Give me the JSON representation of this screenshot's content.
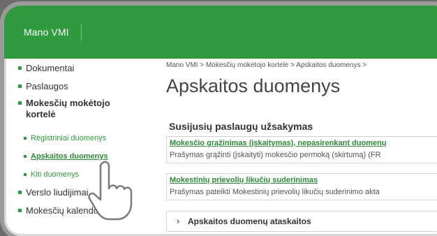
{
  "header": {
    "brand": "Mano VMI"
  },
  "sidebar": {
    "items": [
      {
        "label": "Dokumentai"
      },
      {
        "label": "Paslaugos"
      },
      {
        "label_line1": "Mokesčių mokėtojo",
        "label_line2": "kortelė"
      },
      {
        "label": "Verslo liudijimai"
      },
      {
        "label": "Mokesčių kalendorius"
      }
    ],
    "subitems": [
      {
        "label": "Registriniai duomenys"
      },
      {
        "label": "Apskaitos duomenys"
      },
      {
        "label": "Kiti duomenys"
      }
    ]
  },
  "main": {
    "breadcrumb": "Mano VMI > Mokesčių mokėtojo kortelė > Apskaitos duomenys >",
    "title": "Apskaitos duomenys",
    "section_title": "Susijusių paslaugų užsakymas",
    "services": [
      {
        "link": "Mokesčio grąžinimas (įskaitymas), nepasirenkant duomenų",
        "desc": "Prašymas grąžinti (įskaityti) mokesčio permoką (skirtumą) (FR"
      },
      {
        "link": "Mokestinių prievolių likučių suderinimas",
        "desc": "Prašymas pateikti Mokestinių prievolių likučių suderinimo akta"
      }
    ],
    "collapsed_section": "Apskaitos duomenų ataskaitos"
  },
  "colors": {
    "brand_green": "#2f9a3e",
    "link_green": "#2f8a3a"
  },
  "icons": {
    "cursor": "hand-pointer-icon",
    "chevron": "chevron-right-icon"
  }
}
